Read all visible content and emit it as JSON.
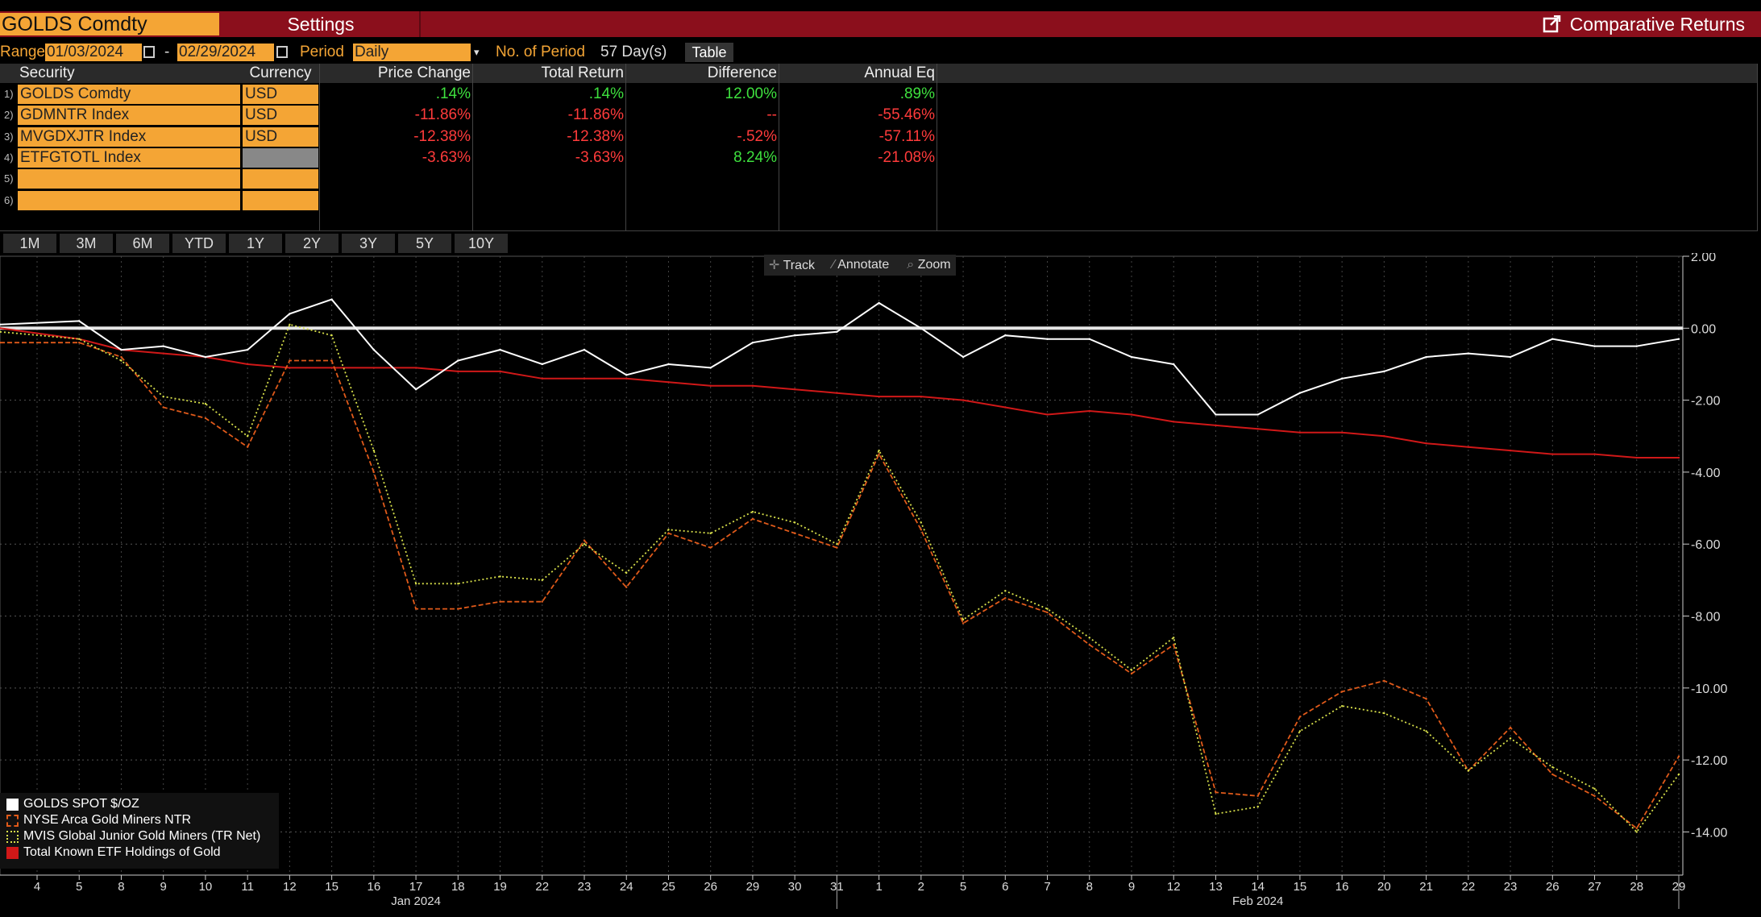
{
  "header": {
    "ticker": "GOLDS Comdty",
    "settings_label": "Settings",
    "title": "Comparative Returns"
  },
  "range": {
    "label": "Range",
    "start": "01/03/2024",
    "dash": "-",
    "end": "02/29/2024",
    "period_label": "Period",
    "period_value": "Daily",
    "nperiod_label": "No. of Period",
    "nperiod_value": "57 Day(s)",
    "table_label": "Table"
  },
  "table": {
    "headers": [
      "Security",
      "Currency",
      "Price Change",
      "Total Return",
      "Difference",
      "Annual Eq"
    ],
    "rows": [
      {
        "n": "1)",
        "security": "GOLDS Comdty",
        "currency": "USD",
        "price_change": ".14%",
        "total_return": ".14%",
        "difference": "12.00%",
        "annual_eq": ".89%",
        "pc_color": "#3ee03e",
        "tr_color": "#3ee03e",
        "diff_color": "#3ee03e",
        "ae_color": "#3ee03e"
      },
      {
        "n": "2)",
        "security": "GDMNTR Index",
        "currency": "USD",
        "price_change": "-11.86%",
        "total_return": "-11.86%",
        "difference": "--",
        "annual_eq": "-55.46%",
        "pc_color": "#ff3b3b",
        "tr_color": "#ff3b3b",
        "diff_color": "#ff3b3b",
        "ae_color": "#ff3b3b"
      },
      {
        "n": "3)",
        "security": "MVGDXJTR Index",
        "currency": "USD",
        "price_change": "-12.38%",
        "total_return": "-12.38%",
        "difference": "-.52%",
        "annual_eq": "-57.11%",
        "pc_color": "#ff3b3b",
        "tr_color": "#ff3b3b",
        "diff_color": "#ff3b3b",
        "ae_color": "#ff3b3b"
      },
      {
        "n": "4)",
        "security": "ETFGTOTL Index",
        "currency": "",
        "price_change": "-3.63%",
        "total_return": "-3.63%",
        "difference": "8.24%",
        "annual_eq": "-21.08%",
        "pc_color": "#ff3b3b",
        "tr_color": "#ff3b3b",
        "diff_color": "#3ee03e",
        "ae_color": "#ff3b3b"
      },
      {
        "n": "5)",
        "security": "",
        "currency": ""
      },
      {
        "n": "6)",
        "security": "",
        "currency": ""
      }
    ]
  },
  "periods": [
    "1M",
    "3M",
    "6M",
    "YTD",
    "1Y",
    "2Y",
    "3Y",
    "5Y",
    "10Y"
  ],
  "tools": {
    "track": "Track",
    "annotate": "Annotate",
    "zoom": "Zoom"
  },
  "chart_data": {
    "type": "line",
    "x": [
      "4",
      "5",
      "8",
      "9",
      "10",
      "11",
      "12",
      "15",
      "16",
      "17",
      "18",
      "19",
      "22",
      "23",
      "24",
      "25",
      "26",
      "29",
      "30",
      "31",
      "1",
      "2",
      "5",
      "6",
      "7",
      "8",
      "9",
      "12",
      "13",
      "14",
      "15",
      "16",
      "20",
      "21",
      "22",
      "23",
      "26",
      "27",
      "28",
      "29"
    ],
    "month_labels": [
      {
        "label": "Jan 2024",
        "at": "17"
      },
      {
        "label": "Feb 2024",
        "at": "14"
      }
    ],
    "month_breaks": [
      "31",
      "29"
    ],
    "ylim": [
      -15.2,
      2.0
    ],
    "yticks": [
      2,
      0,
      -2,
      -4,
      -6,
      -8,
      -10,
      -12,
      -14
    ],
    "ytick_labels": [
      "2.00",
      "0.00",
      "-2.00",
      "-4.00",
      "-6.00",
      "-8.00",
      "-10.00",
      "-12.00",
      "-14.00"
    ],
    "grid": true,
    "legend_position": "bottom-left",
    "series": [
      {
        "name": "GOLDS SPOT $/OZ",
        "color": "#ffffff",
        "style": "solid",
        "values": [
          0.1,
          0.2,
          -0.6,
          -0.5,
          -0.8,
          -0.6,
          0.4,
          0.8,
          -0.6,
          -1.7,
          -0.9,
          -0.6,
          -1.0,
          -0.6,
          -1.3,
          -1.0,
          -1.1,
          -0.4,
          -0.2,
          -0.1,
          0.7,
          0.0,
          -0.8,
          -0.2,
          -0.3,
          -0.3,
          -0.8,
          -1.0,
          -2.4,
          -2.4,
          -1.8,
          -1.4,
          -1.2,
          -0.8,
          -0.7,
          -0.8,
          -0.3,
          -0.5,
          -0.5,
          -0.3
        ]
      },
      {
        "name": "NYSE Arca Gold Miners NTR",
        "color": "#e05a1a",
        "style": "dashed",
        "values": [
          -0.4,
          -0.4,
          -0.8,
          -2.2,
          -2.5,
          -3.3,
          -0.9,
          -0.9,
          -4.0,
          -7.8,
          -7.8,
          -7.6,
          -7.6,
          -5.9,
          -7.2,
          -5.7,
          -6.1,
          -5.3,
          -5.7,
          -6.1,
          -3.5,
          -5.6,
          -8.2,
          -7.5,
          -7.9,
          -8.8,
          -9.6,
          -8.8,
          -12.9,
          -13.0,
          -10.8,
          -10.1,
          -9.8,
          -10.3,
          -12.3,
          -11.1,
          -12.4,
          -13.0,
          -13.9,
          -11.9
        ]
      },
      {
        "name": "MVIS Global Junior Gold Miners (TR Net)",
        "color": "#d8e04a",
        "style": "dotted",
        "values": [
          -0.1,
          -0.3,
          -0.9,
          -1.9,
          -2.1,
          -3.0,
          0.1,
          -0.2,
          -3.4,
          -7.1,
          -7.1,
          -6.9,
          -7.0,
          -6.0,
          -6.8,
          -5.6,
          -5.7,
          -5.1,
          -5.4,
          -6.0,
          -3.4,
          -5.4,
          -8.1,
          -7.3,
          -7.8,
          -8.6,
          -9.5,
          -8.6,
          -13.5,
          -13.3,
          -11.2,
          -10.5,
          -10.7,
          -11.2,
          -12.3,
          -11.4,
          -12.2,
          -12.8,
          -14.0,
          -12.4
        ]
      },
      {
        "name": "Total Known ETF Holdings of Gold",
        "color": "#d01818",
        "style": "solid",
        "values": [
          0.0,
          -0.3,
          -0.6,
          -0.7,
          -0.8,
          -1.0,
          -1.1,
          -1.1,
          -1.1,
          -1.1,
          -1.2,
          -1.2,
          -1.4,
          -1.4,
          -1.4,
          -1.5,
          -1.6,
          -1.6,
          -1.7,
          -1.8,
          -1.9,
          -1.9,
          -2.0,
          -2.2,
          -2.4,
          -2.3,
          -2.4,
          -2.6,
          -2.7,
          -2.8,
          -2.9,
          -2.9,
          -3.0,
          -3.2,
          -3.3,
          -3.4,
          -3.5,
          -3.5,
          -3.6,
          -3.6
        ]
      }
    ]
  }
}
